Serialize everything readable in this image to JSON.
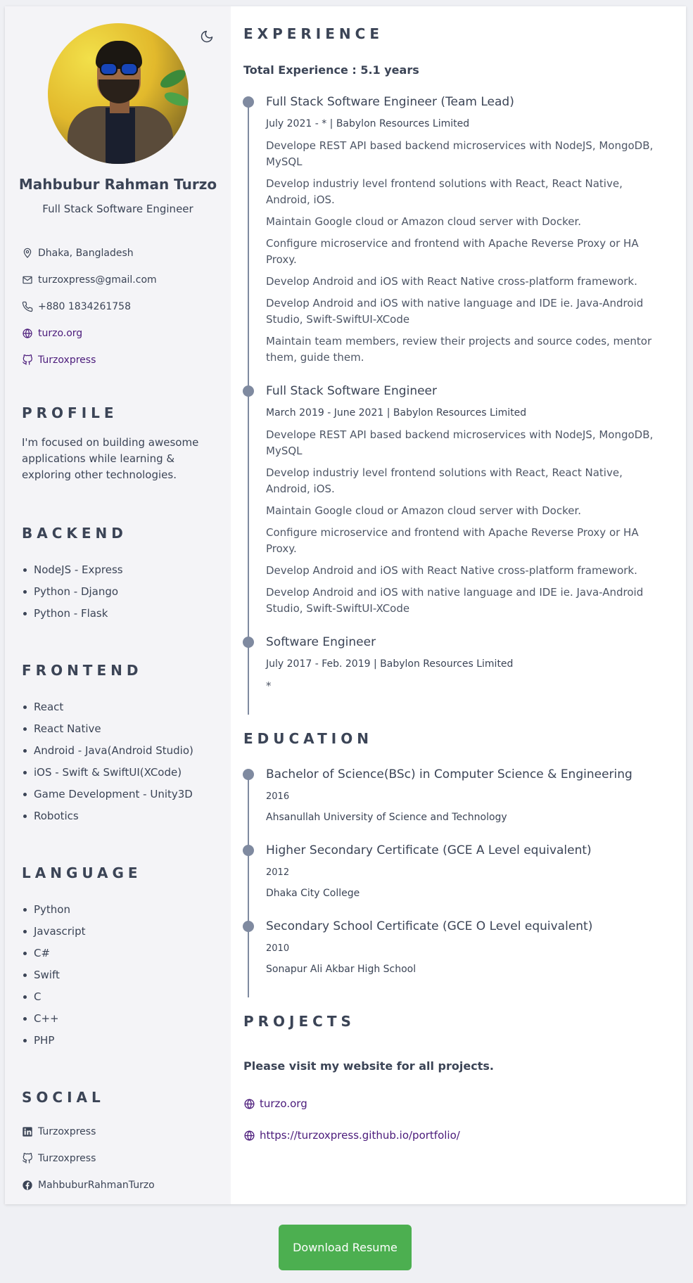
{
  "profile": {
    "name": "Mahbubur Rahman Turzo",
    "title": "Full Stack Software Engineer",
    "location": "Dhaka, Bangladesh",
    "email": "turzoxpress@gmail.com",
    "phone": "+880 1834261758",
    "website": "turzo.org",
    "github": "Turzoxpress"
  },
  "sections": {
    "profile": "PROFILE",
    "backend": "BACKEND",
    "frontend": "FRONTEND",
    "language": "LANGUAGE",
    "social": "SOCIAL",
    "experience": "EXPERIENCE",
    "education": "EDUCATION",
    "projects": "PROJECTS"
  },
  "about": "I'm focused on building awesome applications while learning & exploring other technologies.",
  "backend": [
    "NodeJS - Express",
    "Python - Django",
    "Python - Flask"
  ],
  "frontend": [
    "React",
    "React Native",
    "Android - Java(Android Studio)",
    "iOS - Swift & SwiftUI(XCode)",
    "Game Development - Unity3D",
    "Robotics"
  ],
  "languages": [
    "Python",
    "Javascript",
    "C#",
    "Swift",
    "C",
    "C++",
    "PHP"
  ],
  "social": {
    "linkedin": "Turzoxpress",
    "github": "Turzoxpress",
    "facebook": "MahbuburRahmanTurzo"
  },
  "experience": {
    "total": "Total Experience : 5.1 years",
    "jobs": [
      {
        "title": "Full Stack Software Engineer (Team Lead)",
        "meta": "July 2021 - * | Babylon Resources Limited",
        "items": [
          "Develope REST API based backend microservices with NodeJS, MongoDB, MySQL",
          "Develop industriy level frontend solutions with React, React Native, Android, iOS.",
          "Maintain Google cloud or Amazon cloud server with Docker.",
          "Configure microservice and frontend with Apache Reverse Proxy or HA Proxy.",
          "Develop Android and iOS with React Native cross-platform framework.",
          "Develop Android and iOS with native language and IDE ie. Java-Android Studio, Swift-SwiftUI-XCode",
          "Maintain team members, review their projects and source codes, mentor them, guide them."
        ]
      },
      {
        "title": "Full Stack Software Engineer",
        "meta": "March 2019 - June 2021 | Babylon Resources Limited",
        "items": [
          "Develope REST API based backend microservices with NodeJS, MongoDB, MySQL",
          "Develop industriy level frontend solutions with React, React Native, Android, iOS.",
          "Maintain Google cloud or Amazon cloud server with Docker.",
          "Configure microservice and frontend with Apache Reverse Proxy or HA Proxy.",
          "Develop Android and iOS with React Native cross-platform framework.",
          "Develop Android and iOS with native language and IDE ie. Java-Android Studio, Swift-SwiftUI-XCode"
        ]
      },
      {
        "title": "Software Engineer",
        "meta": "July 2017 - Feb. 2019 | Babylon Resources Limited",
        "items": [
          "*"
        ]
      }
    ]
  },
  "education": [
    {
      "degree": "Bachelor of Science(BSc) in Computer Science & Engineering",
      "year": "2016",
      "school": "Ahsanullah University of Science and Technology"
    },
    {
      "degree": "Higher Secondary Certificate (GCE A Level equivalent)",
      "year": "2012",
      "school": "Dhaka City College"
    },
    {
      "degree": "Secondary School Certificate (GCE O Level equivalent)",
      "year": "2010",
      "school": "Sonapur Ali Akbar High School"
    }
  ],
  "projects": {
    "text": "Please visit my website for all projects.",
    "links": [
      "turzo.org",
      "https://turzoxpress.github.io/portfolio/"
    ]
  },
  "download_label": "Download Resume",
  "colors": {
    "accent_link": "#4a1a7a",
    "button": "#4caf50",
    "timeline": "#7f8aa0"
  }
}
